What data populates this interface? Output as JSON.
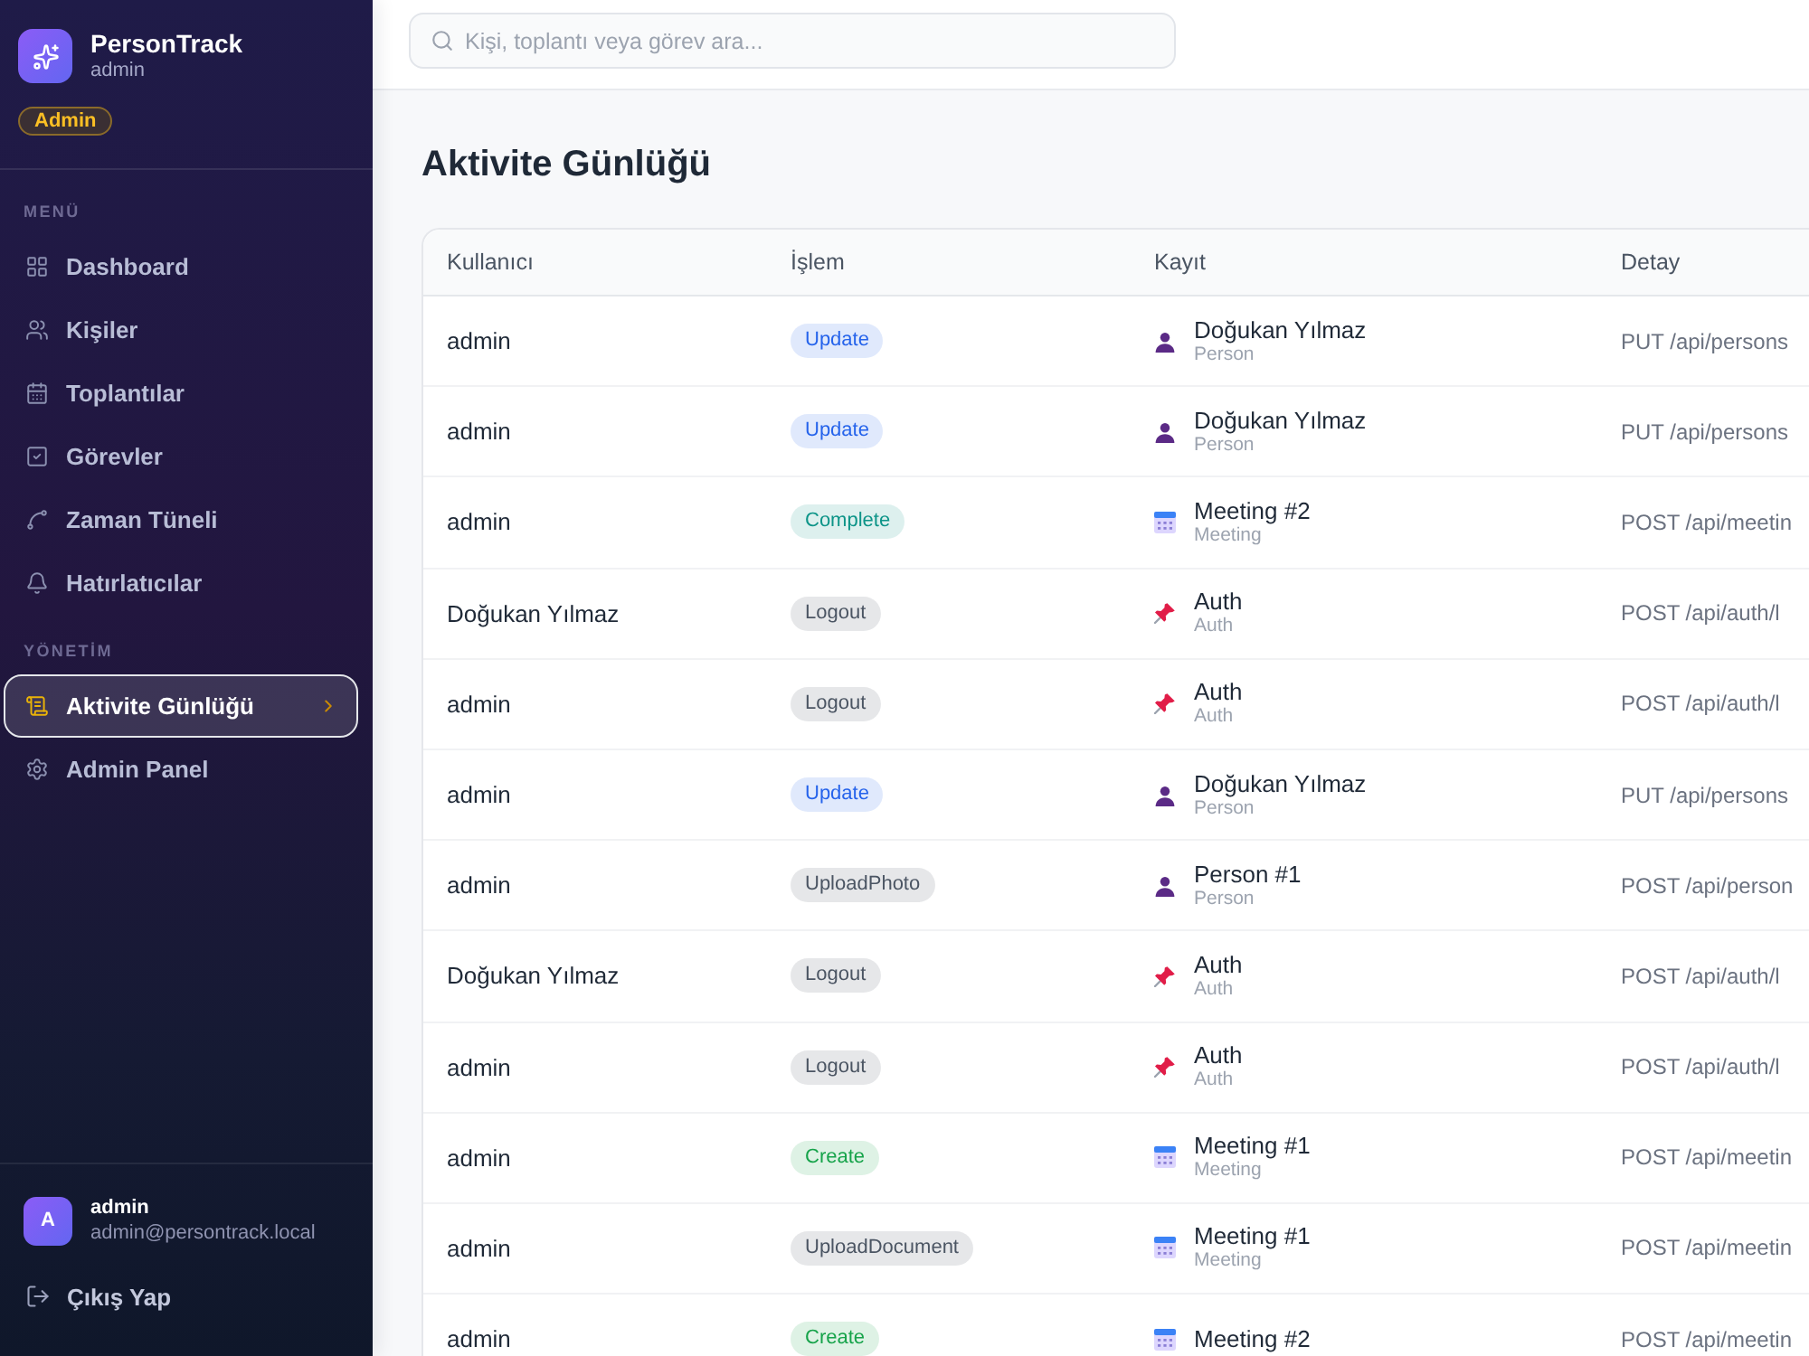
{
  "sidebar": {
    "brand": {
      "name": "PersonTrack",
      "user": "admin",
      "role": "Admin"
    },
    "sections": [
      {
        "title": "MENÜ",
        "items": [
          {
            "label": "Dashboard",
            "selected": false
          },
          {
            "label": "Kişiler",
            "selected": false
          },
          {
            "label": "Toplantılar",
            "selected": false
          },
          {
            "label": "Görevler",
            "selected": false
          },
          {
            "label": "Zaman Tüneli",
            "selected": false
          },
          {
            "label": "Hatırlatıcılar",
            "selected": false
          }
        ]
      },
      {
        "title": "YÖNETİM",
        "items": [
          {
            "label": "Aktivite Günlüğü",
            "selected": true
          },
          {
            "label": "Admin Panel",
            "selected": false
          }
        ]
      }
    ],
    "account": {
      "initial": "A",
      "name": "admin",
      "email": "admin@persontrack.local"
    },
    "logout": "Çıkış Yap"
  },
  "search": {
    "placeholder": "Kişi, toplantı veya görev ara..."
  },
  "page_title": "Aktivite Günlüğü",
  "table": {
    "columns": [
      "Kullanıcı",
      "İşlem",
      "Kayıt",
      "Detay"
    ],
    "rows": [
      {
        "user": "admin",
        "action": {
          "label": "Update",
          "color": "#2563eb"
        },
        "record": {
          "kind": "person",
          "title": "Doğukan Yılmaz",
          "entity": "Person"
        },
        "detail": "PUT /api/persons"
      },
      {
        "user": "admin",
        "action": {
          "label": "Update",
          "color": "#2563eb"
        },
        "record": {
          "kind": "person",
          "title": "Doğukan Yılmaz",
          "entity": "Person"
        },
        "detail": "PUT /api/persons"
      },
      {
        "user": "admin",
        "action": {
          "label": "Complete",
          "color": "#0d9488"
        },
        "record": {
          "kind": "meeting",
          "title": "Meeting #2",
          "entity": "Meeting"
        },
        "detail": "POST /api/meetin"
      },
      {
        "user": "Doğukan Yılmaz",
        "action": {
          "label": "Logout",
          "color": "#4b5563"
        },
        "record": {
          "kind": "auth",
          "title": "Auth",
          "entity": "Auth"
        },
        "detail": "POST /api/auth/l"
      },
      {
        "user": "admin",
        "action": {
          "label": "Logout",
          "color": "#4b5563"
        },
        "record": {
          "kind": "auth",
          "title": "Auth",
          "entity": "Auth"
        },
        "detail": "POST /api/auth/l"
      },
      {
        "user": "admin",
        "action": {
          "label": "Update",
          "color": "#2563eb"
        },
        "record": {
          "kind": "person",
          "title": "Doğukan Yılmaz",
          "entity": "Person"
        },
        "detail": "PUT /api/persons"
      },
      {
        "user": "admin",
        "action": {
          "label": "UploadPhoto",
          "color": "#4b5563"
        },
        "record": {
          "kind": "person",
          "title": "Person #1",
          "entity": "Person"
        },
        "detail": "POST /api/person"
      },
      {
        "user": "Doğukan Yılmaz",
        "action": {
          "label": "Logout",
          "color": "#4b5563"
        },
        "record": {
          "kind": "auth",
          "title": "Auth",
          "entity": "Auth"
        },
        "detail": "POST /api/auth/l"
      },
      {
        "user": "admin",
        "action": {
          "label": "Logout",
          "color": "#4b5563"
        },
        "record": {
          "kind": "auth",
          "title": "Auth",
          "entity": "Auth"
        },
        "detail": "POST /api/auth/l"
      },
      {
        "user": "admin",
        "action": {
          "label": "Create",
          "color": "#16a34a"
        },
        "record": {
          "kind": "meeting",
          "title": "Meeting #1",
          "entity": "Meeting"
        },
        "detail": "POST /api/meetin"
      },
      {
        "user": "admin",
        "action": {
          "label": "UploadDocument",
          "color": "#4b5563"
        },
        "record": {
          "kind": "meeting",
          "title": "Meeting #1",
          "entity": "Meeting"
        },
        "detail": "POST /api/meetin"
      },
      {
        "user": "admin",
        "action": {
          "label": "Create",
          "color": "#16a34a"
        },
        "record": {
          "kind": "meeting",
          "title": "Meeting #2"
        },
        "detail": "POST /api/meetin"
      }
    ]
  }
}
